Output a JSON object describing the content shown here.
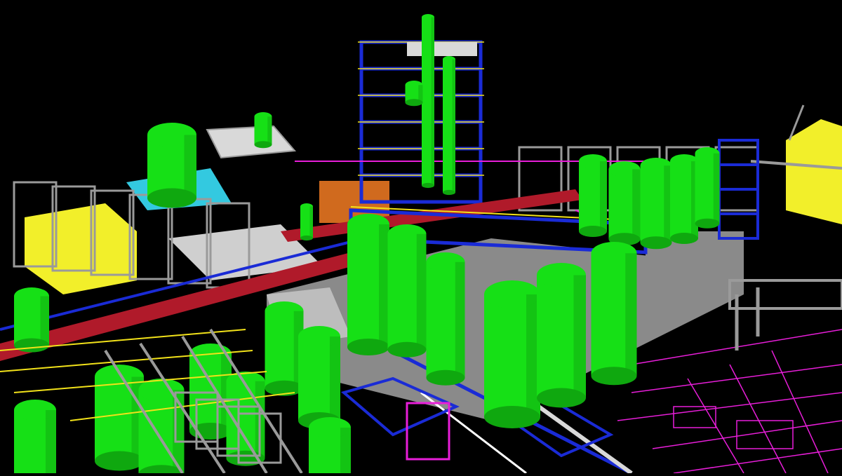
{
  "scene": {
    "description_kind": "3d-plant-model-viewport",
    "palette": {
      "background": "#000000",
      "vessel": "#16e016",
      "vessel_shade": "#0fa80f",
      "structure_blue": "#1a2bd6",
      "handrail_yellow": "#f2e21a",
      "steel_gray": "#9a9a9a",
      "slab_gray": "#8a8a8a",
      "pipe_red": "#b01a2a",
      "pipe_magenta": "#e81ed9",
      "cyan_pad": "#33c9e0",
      "building_yellow": "#f2ef2a",
      "orange_shed": "#d06a1e"
    },
    "icons": [
      "tank-icon",
      "structure-icon"
    ]
  }
}
